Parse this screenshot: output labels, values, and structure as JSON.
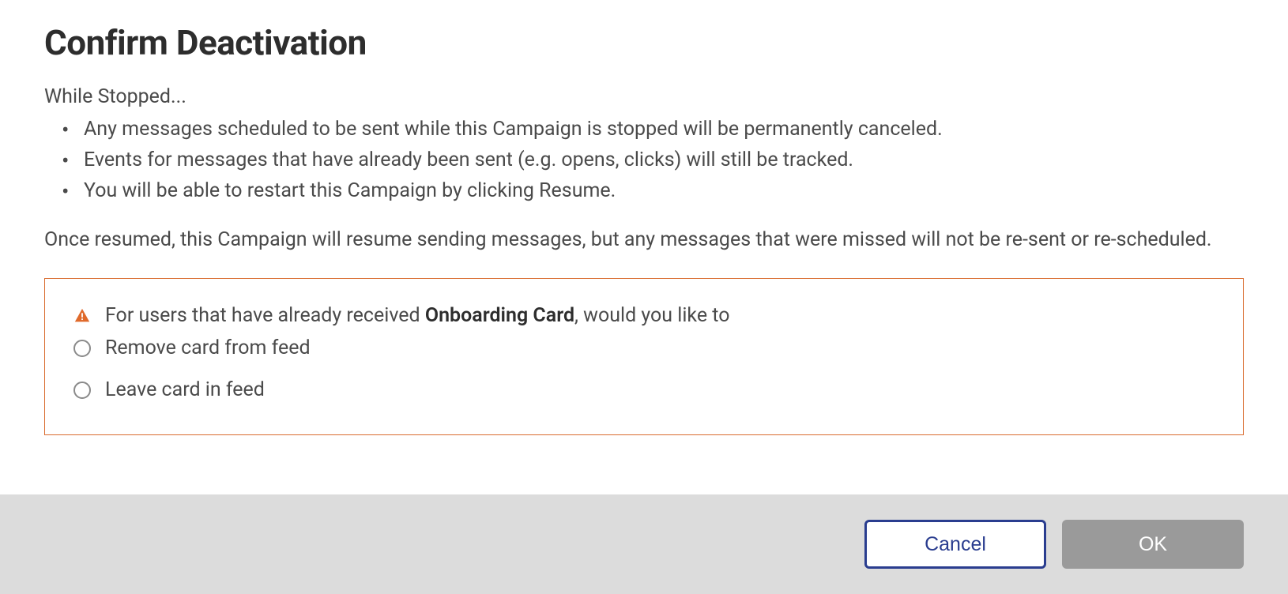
{
  "dialog": {
    "title": "Confirm Deactivation",
    "intro": "While Stopped...",
    "bullets": [
      "Any messages scheduled to be sent while this Campaign is stopped will be permanently canceled.",
      "Events for messages that have already been sent (e.g. opens, clicks) will still be tracked.",
      "You will be able to restart this Campaign by clicking Resume."
    ],
    "resume_text": "Once resumed, this Campaign will resume sending messages, but any messages that were missed will not be re-sent or re-scheduled."
  },
  "warning": {
    "prompt_before": "For users that have already received ",
    "prompt_bold": "Onboarding Card",
    "prompt_after": ", would you like to",
    "options": [
      "Remove card from feed",
      "Leave card in feed"
    ]
  },
  "footer": {
    "cancel_label": "Cancel",
    "ok_label": "OK"
  },
  "colors": {
    "warning_border": "#d96b2e",
    "warning_icon": "#e06a2b",
    "primary_button_border": "#2a3d8f"
  }
}
